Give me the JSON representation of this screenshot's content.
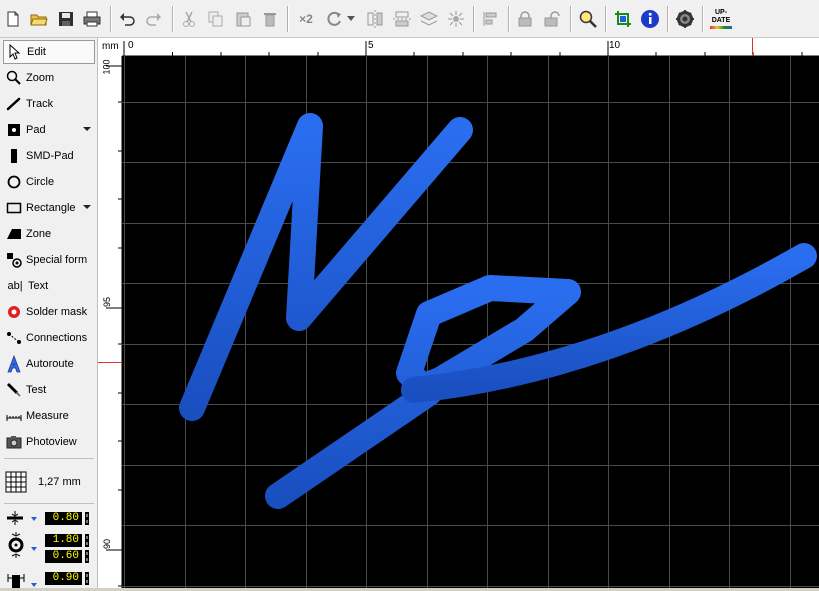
{
  "toolbar": {
    "buttons": [
      "new-file-icon",
      "open-folder-icon",
      "save-icon",
      "print-icon",
      "undo-icon",
      "redo-icon",
      "cut-icon",
      "copy-icon",
      "paste-icon",
      "delete-icon",
      "duplicate-icon",
      "rotate-icon",
      "mirror-vertical-icon",
      "mirror-horizontal-icon",
      "flip-layer-icon",
      "explode-icon",
      "align-icon",
      "lock-icon",
      "unlock-icon",
      "zoom-icon",
      "crop-icon",
      "info-icon",
      "settings-icon",
      "update-icon"
    ],
    "duplicate_label": "×2",
    "update_label_1": "UP-",
    "update_label_2": "DATE"
  },
  "tools": [
    {
      "label": "Edit",
      "icon": "pointer-icon",
      "active": true
    },
    {
      "label": "Zoom",
      "icon": "magnifier-icon"
    },
    {
      "label": "Track",
      "icon": "track-icon"
    },
    {
      "label": "Pad",
      "icon": "pad-icon",
      "dropdown": true
    },
    {
      "label": "SMD-Pad",
      "icon": "smd-pad-icon"
    },
    {
      "label": "Circle",
      "icon": "circle-icon"
    },
    {
      "label": "Rectangle",
      "icon": "rectangle-icon",
      "dropdown": true
    },
    {
      "label": "Zone",
      "icon": "zone-icon"
    },
    {
      "label": "Special form",
      "icon": "special-form-icon"
    },
    {
      "label": "Text",
      "icon": "text-icon",
      "icon_text": "ab|"
    },
    {
      "label": "Solder mask",
      "icon": "solder-mask-icon"
    },
    {
      "label": "Connections",
      "icon": "connections-icon"
    },
    {
      "label": "Autoroute",
      "icon": "autoroute-icon"
    },
    {
      "label": "Test",
      "icon": "test-icon"
    },
    {
      "label": "Measure",
      "icon": "measure-icon"
    },
    {
      "label": "Photoview",
      "icon": "camera-icon"
    }
  ],
  "grid": {
    "value": "1,27 mm"
  },
  "params": {
    "track_width": "0.80",
    "pad_outer": "1.80",
    "pad_inner": "0.60",
    "smd_size": "0.90"
  },
  "ruler": {
    "unit": "mm",
    "top_labels": [
      "0",
      "5",
      "10"
    ],
    "left_labels": [
      "100",
      "95",
      "90"
    ]
  },
  "colors": {
    "canvas_bg": "#000000",
    "grid": "#4a4a4a",
    "track": "#1f5fd9",
    "ruler_marker": "#e03030"
  }
}
